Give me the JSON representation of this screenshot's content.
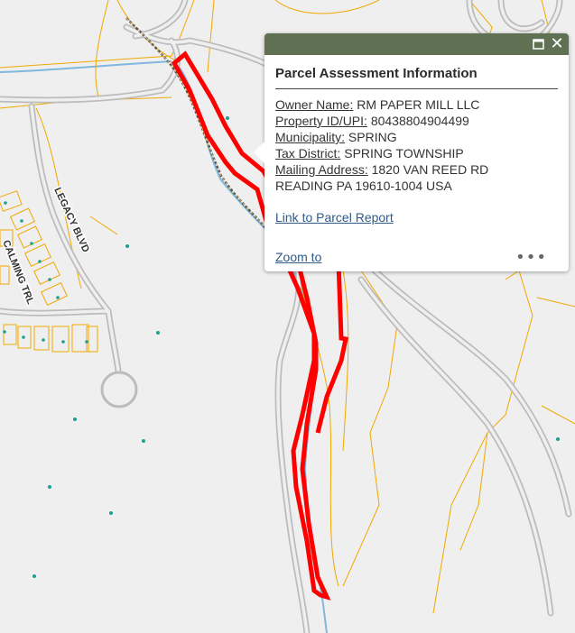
{
  "map": {
    "road_labels": [
      "LEGACY BLVD",
      "CALMING TRL"
    ],
    "colors": {
      "background": "#efefef",
      "road": "#bcbcbc",
      "parcel": "#f0a800",
      "selection": "#ff0000",
      "water": "#7fb7dd",
      "dots": "#1aa192"
    }
  },
  "popup": {
    "title": "Parcel Assessment Information",
    "fields": [
      {
        "label": "Owner Name:",
        "value": "RM PAPER MILL LLC"
      },
      {
        "label": "Property ID/UPI:",
        "value": "80438804904499"
      },
      {
        "label": "Municipality:",
        "value": "SPRING"
      },
      {
        "label": "Tax District:",
        "value": "SPRING TOWNSHIP"
      },
      {
        "label": "Mailing Address:",
        "value": "1820 VAN REED RD"
      }
    ],
    "address_line2": "READING PA 19610-1004 USA",
    "link_text": "Link to Parcel Report",
    "zoom_label": "Zoom to",
    "more_icon": "•••",
    "close_icon": "✕",
    "header_color": "#5f7152"
  }
}
